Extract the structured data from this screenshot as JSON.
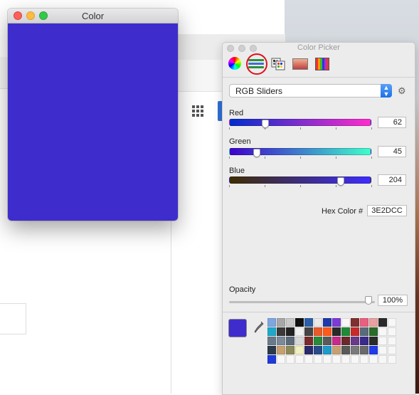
{
  "color_window": {
    "title": "Color",
    "color": "#3E2DCC"
  },
  "picker": {
    "title": "Color Picker",
    "modes": [
      "color-wheel",
      "color-sliders",
      "color-palettes",
      "image-palettes",
      "crayon-pencils"
    ],
    "selected_mode": "color-sliders",
    "slider_mode": "RGB Sliders",
    "red": {
      "label": "Red",
      "value": "62"
    },
    "green": {
      "label": "Green",
      "value": "45"
    },
    "blue": {
      "label": "Blue",
      "value": "204"
    },
    "hex_label": "Hex Color #",
    "hex_value": "3E2DCC",
    "opacity_label": "Opacity",
    "opacity_value": "100%",
    "swatches": [
      "#7ea6e0",
      "#a7a7a7",
      "#c9c9c9",
      "#111111",
      "#2b5fa8",
      "#e9e9e9",
      "#1f3aa8",
      "#7b3bd6",
      "#f7f7f7",
      "#7f2f2f",
      "#e86080",
      "#e8a0a0",
      "#2a2a2a",
      "#f7f7f7",
      "#1fa8c9",
      "#3a3a3a",
      "#222222",
      "#f0f0f0",
      "#444444",
      "#e85a2a",
      "#ff5a1a",
      "#2a2a2a",
      "#1f8a3a",
      "#c82a2a",
      "#5a6a7a",
      "#2a6a2a",
      "#f7f7f7",
      "#f7f7f7",
      "#6a7a8a",
      "#7a8a9a",
      "#5a6a7a",
      "#d8d8d8",
      "#7a2a2a",
      "#2a8a3a",
      "#5a5a5a",
      "#c82a8a",
      "#6a2a2a",
      "#6a3a8a",
      "#3a2a8a",
      "#2a2a2a",
      "#f7f7f7",
      "#f7f7f7",
      "#2a3a4a",
      "#c8a070",
      "#8a8a5a",
      "#f0f0c0",
      "#2a2a6a",
      "#2a4a8a",
      "#1f9ac9",
      "#c8a070",
      "#5a5a5a",
      "#7a7a7a",
      "#6a6a6a",
      "#1f3ae8",
      "#f7f7f7",
      "#f7f7f7",
      "#1f3ad8",
      "#f7f7f7",
      "#f7f7f7",
      "#f7f7f7",
      "#f7f7f7",
      "#f7f7f7",
      "#f7f7f7",
      "#f7f7f7",
      "#f7f7f7",
      "#f7f7f7",
      "#f7f7f7",
      "#f7f7f7",
      "#f7f7f7",
      "#f7f7f7"
    ]
  }
}
